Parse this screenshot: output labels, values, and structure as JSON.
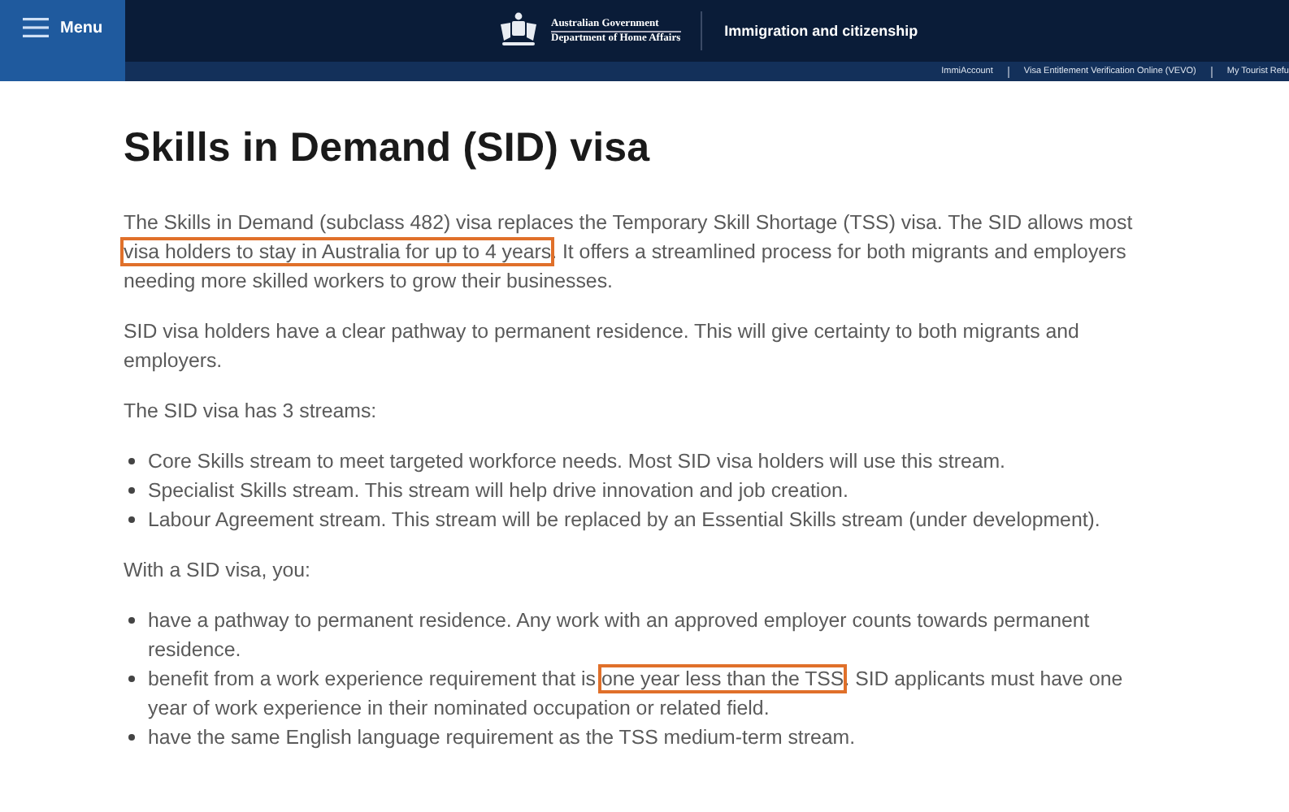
{
  "header": {
    "menu_label": "Menu",
    "government": "Australian Government",
    "department": "Department of Home Affairs",
    "site_title": "Immigration and citizenship",
    "links": [
      "ImmiAccount",
      "Visa Entitlement Verification Online (VEVO)",
      "My Tourist Refu"
    ]
  },
  "title": "Skills in Demand (SID) visa",
  "content": [
    {
      "kind": "paragraph",
      "segments": [
        {
          "text": "The Skills in Demand (subclass 482) visa replaces the Temporary Skill Shortage (TSS) visa. The SID allows most ",
          "highlighted": false
        },
        {
          "text": "visa holders to stay in Australia for up to 4 years",
          "highlighted": true
        },
        {
          "text": ". It offers a streamlined process for both migrants and employers needing more skilled workers to grow their businesses.",
          "highlighted": false
        }
      ]
    },
    {
      "kind": "paragraph",
      "segments": [
        {
          "text": "SID visa holders have a clear pathway to permanent residence. This will give certainty to both migrants and employers.",
          "highlighted": false
        }
      ]
    },
    {
      "kind": "paragraph",
      "segments": [
        {
          "text": "The SID visa has 3 streams:",
          "highlighted": false
        }
      ]
    },
    {
      "kind": "list",
      "items": [
        [
          {
            "text": "Core Skills stream to meet targeted workforce needs. Most SID visa holders will use this stream.",
            "highlighted": false
          }
        ],
        [
          {
            "text": "Specialist Skills stream. This stream will help drive innovation and job creation.",
            "highlighted": false
          }
        ],
        [
          {
            "text": "Labour Agreement stream. This stream will be replaced by an Essential Skills stream (under development).",
            "highlighted": false
          }
        ]
      ]
    },
    {
      "kind": "paragraph",
      "segments": [
        {
          "text": "With a SID visa, you:",
          "highlighted": false
        }
      ]
    },
    {
      "kind": "list",
      "items": [
        [
          {
            "text": "have a pathway to permanent residence. Any work with an approved employer counts towards permanent residence.",
            "highlighted": false
          }
        ],
        [
          {
            "text": "benefit from a work experience requirement that is ",
            "highlighted": false
          },
          {
            "text": "one year less than the TSS",
            "highlighted": true
          },
          {
            "text": ". SID applicants must have one year of work experience in their nominated occupation or related field.",
            "highlighted": false
          }
        ],
        [
          {
            "text": "have the same English language requirement as the TSS medium-term stream.",
            "highlighted": false
          }
        ]
      ]
    }
  ]
}
